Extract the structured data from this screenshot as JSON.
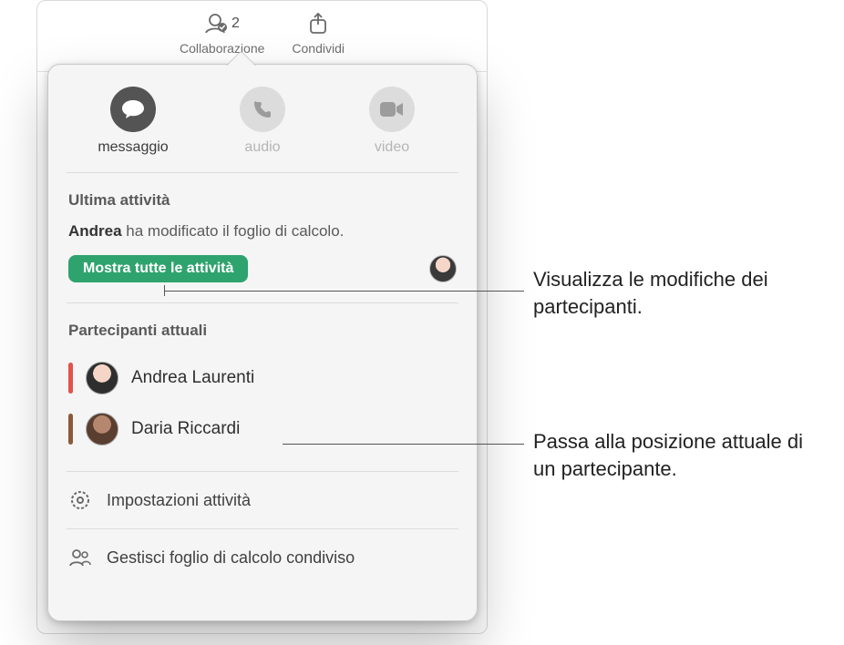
{
  "toolbar": {
    "collaborate": {
      "label": "Collaborazione",
      "count": "2"
    },
    "share": {
      "label": "Condividi"
    }
  },
  "popover": {
    "actions": {
      "message": "messaggio",
      "audio": "audio",
      "video": "video"
    },
    "latest_activity_title": "Ultima attività",
    "latest_activity_actor": "Andrea",
    "latest_activity_rest": " ha modificato il foglio di calcolo.",
    "show_all": "Mostra tutte le attività",
    "participants_title": "Partecipanti attuali",
    "participants": [
      {
        "name": "Andrea Laurenti",
        "color": "red"
      },
      {
        "name": "Daria Riccardi",
        "color": "brown"
      }
    ],
    "activity_settings": "Impostazioni attività",
    "manage_shared": "Gestisci foglio di calcolo condiviso"
  },
  "callouts": {
    "changes": "Visualizza le modifiche dei partecipanti.",
    "position": "Passa alla posizione attuale di un partecipante."
  }
}
